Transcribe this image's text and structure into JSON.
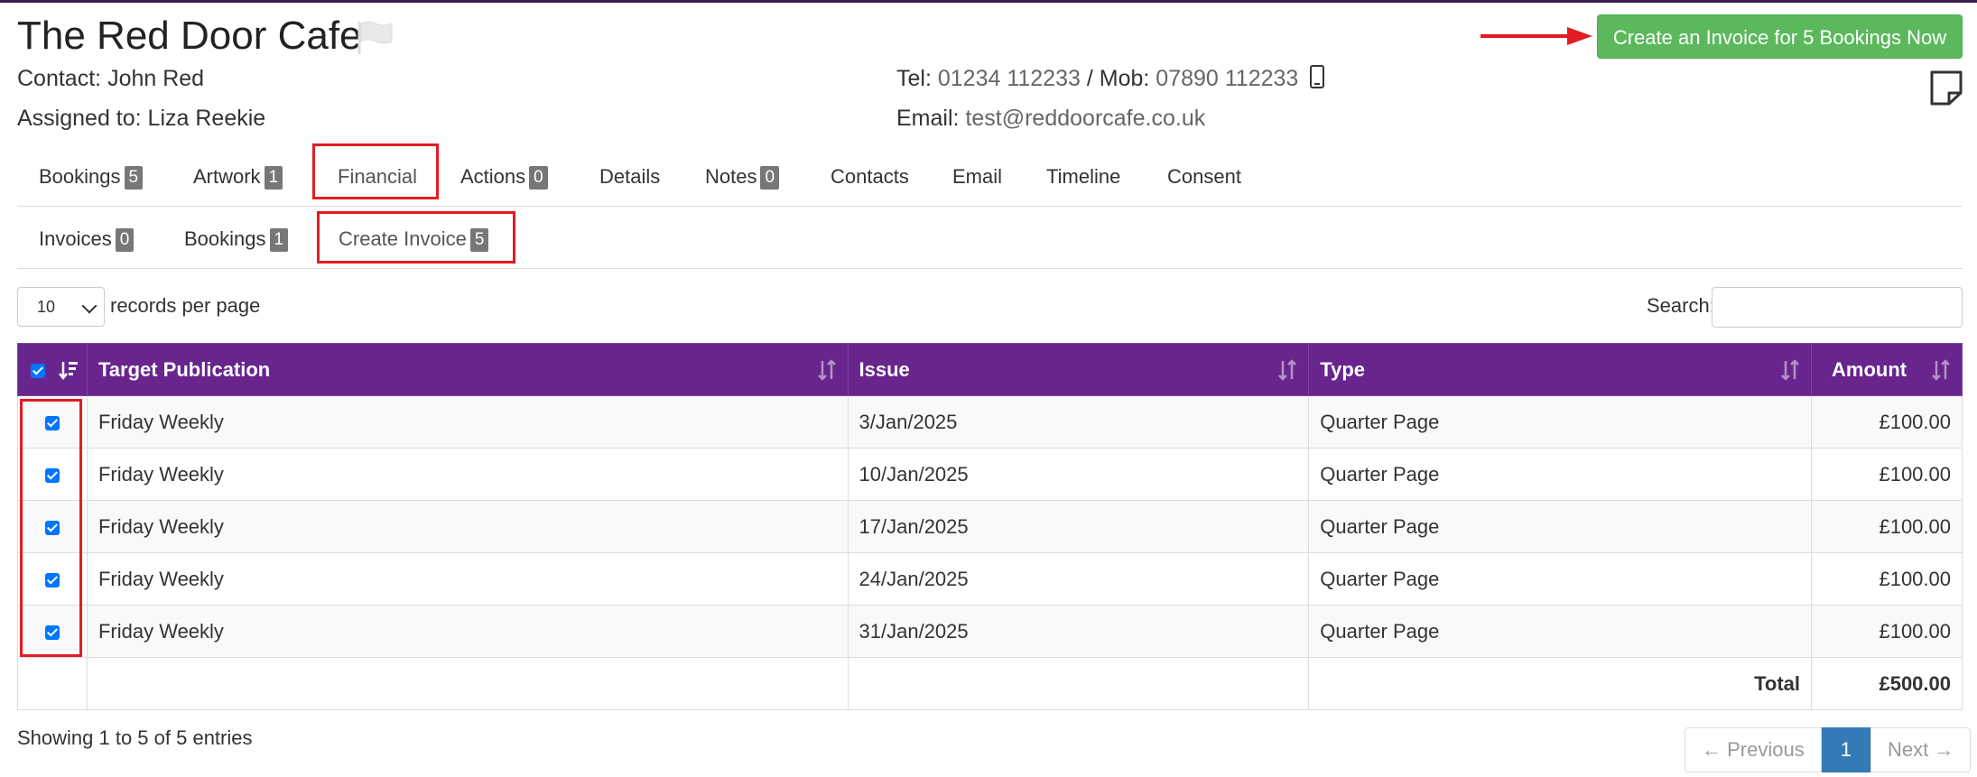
{
  "header": {
    "title": "The Red Door Cafe",
    "flag_icon": "flag-icon",
    "contact_label": "Contact:",
    "contact_name": "John Red",
    "assigned_label": "Assigned to:",
    "assigned_name": "Liza Reekie",
    "tel_label": "Tel:",
    "tel_value": "01234 112233",
    "mob_label": "/ Mob:",
    "mob_value": "07890 112233",
    "email_label": "Email:",
    "email_value": "test@reddoorcafe.co.uk",
    "create_button": "Create an Invoice for 5 Bookings Now"
  },
  "main_tabs": [
    {
      "label": "Bookings",
      "badge": "5"
    },
    {
      "label": "Artwork",
      "badge": "1"
    },
    {
      "label": "Financial",
      "badge": ""
    },
    {
      "label": "Actions",
      "badge": "0"
    },
    {
      "label": "Details",
      "badge": ""
    },
    {
      "label": "Notes",
      "badge": "0"
    },
    {
      "label": "Contacts",
      "badge": ""
    },
    {
      "label": "Email",
      "badge": ""
    },
    {
      "label": "Timeline",
      "badge": ""
    },
    {
      "label": "Consent",
      "badge": ""
    }
  ],
  "sub_tabs": [
    {
      "label": "Invoices",
      "badge": "0"
    },
    {
      "label": "Bookings",
      "badge": "1"
    },
    {
      "label": "Create Invoice",
      "badge": "5"
    }
  ],
  "table_controls": {
    "page_size": "10",
    "records_per_page": "records per page",
    "search_label": "Search:",
    "search_value": ""
  },
  "table": {
    "columns": [
      "Target Publication",
      "Issue",
      "Type",
      "Amount"
    ],
    "rows": [
      {
        "checked": true,
        "publication": "Friday Weekly",
        "issue": "3/Jan/2025",
        "type": "Quarter Page",
        "amount": "£100.00"
      },
      {
        "checked": true,
        "publication": "Friday Weekly",
        "issue": "10/Jan/2025",
        "type": "Quarter Page",
        "amount": "£100.00"
      },
      {
        "checked": true,
        "publication": "Friday Weekly",
        "issue": "17/Jan/2025",
        "type": "Quarter Page",
        "amount": "£100.00"
      },
      {
        "checked": true,
        "publication": "Friday Weekly",
        "issue": "24/Jan/2025",
        "type": "Quarter Page",
        "amount": "£100.00"
      },
      {
        "checked": true,
        "publication": "Friday Weekly",
        "issue": "31/Jan/2025",
        "type": "Quarter Page",
        "amount": "£100.00"
      }
    ],
    "total_label": "Total",
    "total_value": "£500.00"
  },
  "footer": {
    "showing": "Showing 1 to 5 of 5 entries",
    "previous": "← Previous",
    "page": "1",
    "next": "Next →"
  },
  "colors": {
    "header_purple": "#68258d",
    "button_green": "#5cb85c",
    "annotation_red": "#e31b23",
    "pager_active": "#337ab7"
  }
}
